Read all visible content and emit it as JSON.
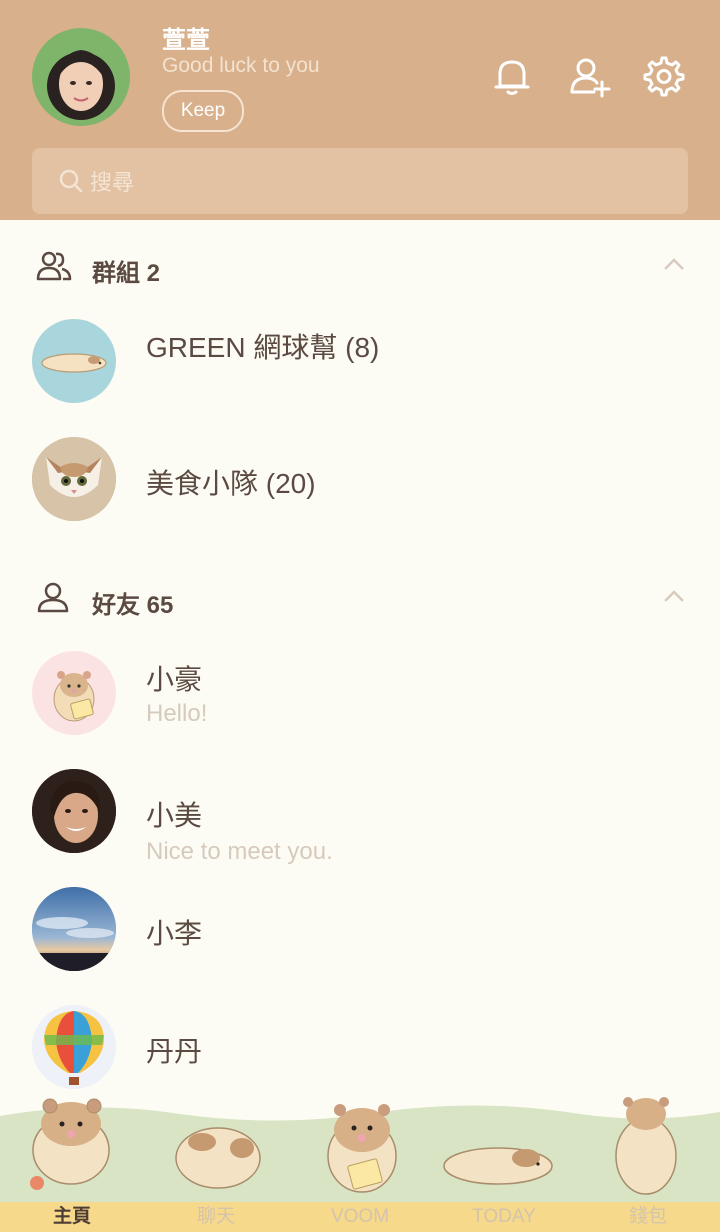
{
  "profile": {
    "name": "萱萱",
    "status": "Good luck to you",
    "keep_label": "Keep"
  },
  "header_icons": [
    "bell-icon",
    "add-friend-icon",
    "settings-gear-icon"
  ],
  "search": {
    "placeholder": "搜尋"
  },
  "groups": {
    "title": "群組 2",
    "items": [
      {
        "name": "GREEN 網球幫 (8)"
      },
      {
        "name": "美食小隊 (20)"
      }
    ]
  },
  "friends": {
    "title": "好友 65",
    "items": [
      {
        "name": "小豪",
        "status": "Hello!"
      },
      {
        "name": "小美",
        "status": "Nice to meet you."
      },
      {
        "name": "小李"
      },
      {
        "name": "丹丹"
      }
    ]
  },
  "tabs": [
    {
      "label": "主頁",
      "active": true
    },
    {
      "label": "聊天"
    },
    {
      "label": "VOOM"
    },
    {
      "label": "TODAY"
    },
    {
      "label": "錢包"
    }
  ],
  "colors": {
    "header_bg": "#d8b08c",
    "content_bg": "#fdfcf4",
    "tabbar_bg": "#f7d98c",
    "notification_dot": "#e88868"
  }
}
